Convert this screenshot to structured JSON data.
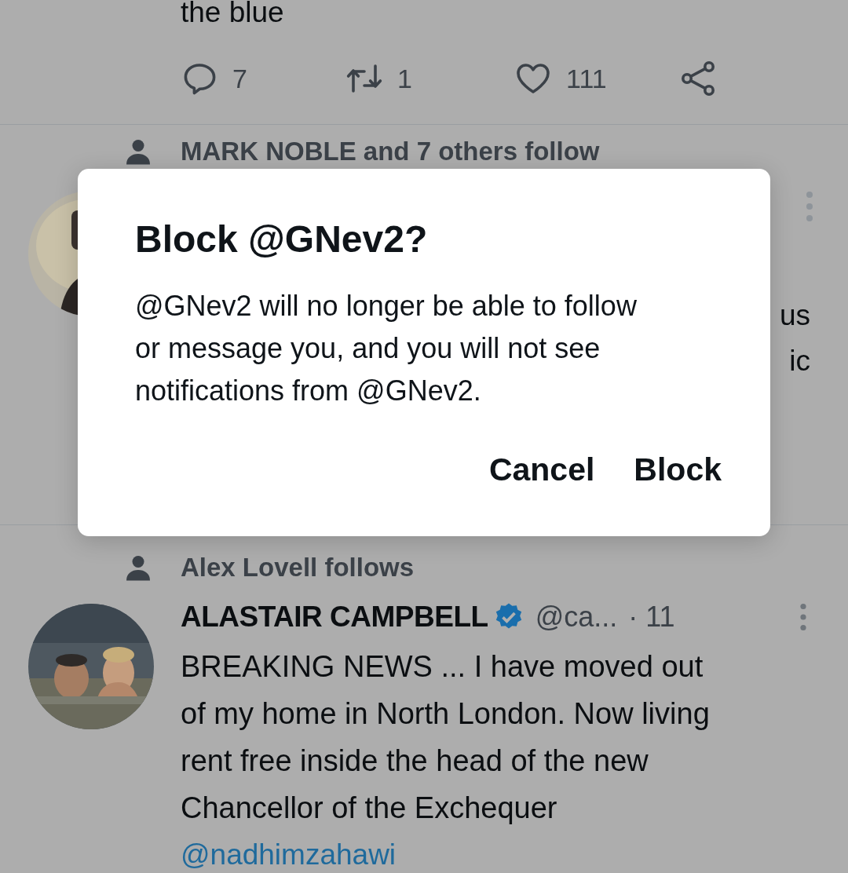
{
  "feed": [
    {
      "kind": "tail",
      "body_end": "the blue",
      "actions": [
        {
          "kind": "reply",
          "count": "7"
        },
        {
          "kind": "retweet",
          "count": "1"
        },
        {
          "kind": "like",
          "count": "111"
        },
        {
          "kind": "share"
        }
      ]
    },
    {
      "kind": "hidden",
      "social_context": "MARK NOBLE and 7 others follow",
      "body_fragments": [
        "us",
        "ic"
      ]
    },
    {
      "kind": "full",
      "social_context": "Alex Lovell follows",
      "author": {
        "name": "ALASTAIR CAMPBELL",
        "verified": true,
        "handle": "@ca...",
        "time": "· 11"
      },
      "body": "BREAKING NEWS ... I have moved out of my home in North London. Now living rent free inside the head of the new Chancellor of the Exchequer",
      "link": "@nadhimzahawi"
    }
  ],
  "dialog": {
    "title": "Block @GNev2?",
    "message": "@GNev2 will no longer be able to follow or message you, and you will not see notifications from @GNev2.",
    "buttons": [
      "Cancel",
      "Block"
    ]
  }
}
